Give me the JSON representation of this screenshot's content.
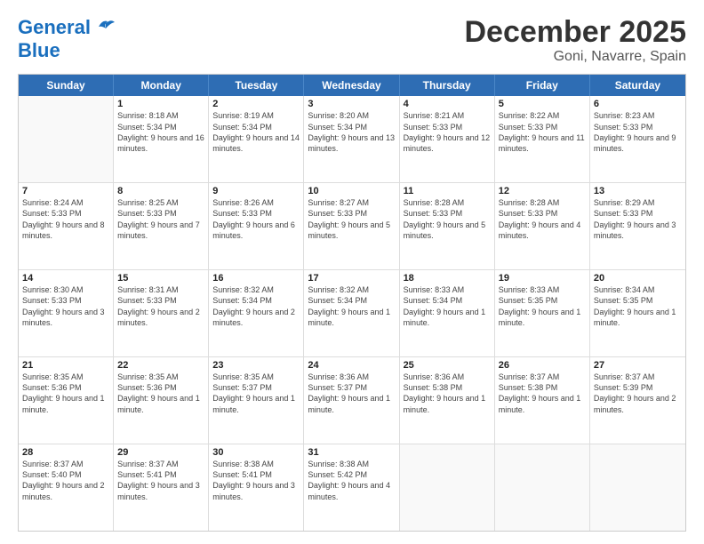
{
  "logo": {
    "line1": "General",
    "line2": "Blue"
  },
  "title": "December 2025",
  "subtitle": "Goni, Navarre, Spain",
  "weekdays": [
    "Sunday",
    "Monday",
    "Tuesday",
    "Wednesday",
    "Thursday",
    "Friday",
    "Saturday"
  ],
  "rows": [
    [
      {
        "day": "",
        "sunrise": "",
        "sunset": "",
        "daylight": ""
      },
      {
        "day": "1",
        "sunrise": "Sunrise: 8:18 AM",
        "sunset": "Sunset: 5:34 PM",
        "daylight": "Daylight: 9 hours and 16 minutes."
      },
      {
        "day": "2",
        "sunrise": "Sunrise: 8:19 AM",
        "sunset": "Sunset: 5:34 PM",
        "daylight": "Daylight: 9 hours and 14 minutes."
      },
      {
        "day": "3",
        "sunrise": "Sunrise: 8:20 AM",
        "sunset": "Sunset: 5:34 PM",
        "daylight": "Daylight: 9 hours and 13 minutes."
      },
      {
        "day": "4",
        "sunrise": "Sunrise: 8:21 AM",
        "sunset": "Sunset: 5:33 PM",
        "daylight": "Daylight: 9 hours and 12 minutes."
      },
      {
        "day": "5",
        "sunrise": "Sunrise: 8:22 AM",
        "sunset": "Sunset: 5:33 PM",
        "daylight": "Daylight: 9 hours and 11 minutes."
      },
      {
        "day": "6",
        "sunrise": "Sunrise: 8:23 AM",
        "sunset": "Sunset: 5:33 PM",
        "daylight": "Daylight: 9 hours and 9 minutes."
      }
    ],
    [
      {
        "day": "7",
        "sunrise": "Sunrise: 8:24 AM",
        "sunset": "Sunset: 5:33 PM",
        "daylight": "Daylight: 9 hours and 8 minutes."
      },
      {
        "day": "8",
        "sunrise": "Sunrise: 8:25 AM",
        "sunset": "Sunset: 5:33 PM",
        "daylight": "Daylight: 9 hours and 7 minutes."
      },
      {
        "day": "9",
        "sunrise": "Sunrise: 8:26 AM",
        "sunset": "Sunset: 5:33 PM",
        "daylight": "Daylight: 9 hours and 6 minutes."
      },
      {
        "day": "10",
        "sunrise": "Sunrise: 8:27 AM",
        "sunset": "Sunset: 5:33 PM",
        "daylight": "Daylight: 9 hours and 5 minutes."
      },
      {
        "day": "11",
        "sunrise": "Sunrise: 8:28 AM",
        "sunset": "Sunset: 5:33 PM",
        "daylight": "Daylight: 9 hours and 5 minutes."
      },
      {
        "day": "12",
        "sunrise": "Sunrise: 8:28 AM",
        "sunset": "Sunset: 5:33 PM",
        "daylight": "Daylight: 9 hours and 4 minutes."
      },
      {
        "day": "13",
        "sunrise": "Sunrise: 8:29 AM",
        "sunset": "Sunset: 5:33 PM",
        "daylight": "Daylight: 9 hours and 3 minutes."
      }
    ],
    [
      {
        "day": "14",
        "sunrise": "Sunrise: 8:30 AM",
        "sunset": "Sunset: 5:33 PM",
        "daylight": "Daylight: 9 hours and 3 minutes."
      },
      {
        "day": "15",
        "sunrise": "Sunrise: 8:31 AM",
        "sunset": "Sunset: 5:33 PM",
        "daylight": "Daylight: 9 hours and 2 minutes."
      },
      {
        "day": "16",
        "sunrise": "Sunrise: 8:32 AM",
        "sunset": "Sunset: 5:34 PM",
        "daylight": "Daylight: 9 hours and 2 minutes."
      },
      {
        "day": "17",
        "sunrise": "Sunrise: 8:32 AM",
        "sunset": "Sunset: 5:34 PM",
        "daylight": "Daylight: 9 hours and 1 minute."
      },
      {
        "day": "18",
        "sunrise": "Sunrise: 8:33 AM",
        "sunset": "Sunset: 5:34 PM",
        "daylight": "Daylight: 9 hours and 1 minute."
      },
      {
        "day": "19",
        "sunrise": "Sunrise: 8:33 AM",
        "sunset": "Sunset: 5:35 PM",
        "daylight": "Daylight: 9 hours and 1 minute."
      },
      {
        "day": "20",
        "sunrise": "Sunrise: 8:34 AM",
        "sunset": "Sunset: 5:35 PM",
        "daylight": "Daylight: 9 hours and 1 minute."
      }
    ],
    [
      {
        "day": "21",
        "sunrise": "Sunrise: 8:35 AM",
        "sunset": "Sunset: 5:36 PM",
        "daylight": "Daylight: 9 hours and 1 minute."
      },
      {
        "day": "22",
        "sunrise": "Sunrise: 8:35 AM",
        "sunset": "Sunset: 5:36 PM",
        "daylight": "Daylight: 9 hours and 1 minute."
      },
      {
        "day": "23",
        "sunrise": "Sunrise: 8:35 AM",
        "sunset": "Sunset: 5:37 PM",
        "daylight": "Daylight: 9 hours and 1 minute."
      },
      {
        "day": "24",
        "sunrise": "Sunrise: 8:36 AM",
        "sunset": "Sunset: 5:37 PM",
        "daylight": "Daylight: 9 hours and 1 minute."
      },
      {
        "day": "25",
        "sunrise": "Sunrise: 8:36 AM",
        "sunset": "Sunset: 5:38 PM",
        "daylight": "Daylight: 9 hours and 1 minute."
      },
      {
        "day": "26",
        "sunrise": "Sunrise: 8:37 AM",
        "sunset": "Sunset: 5:38 PM",
        "daylight": "Daylight: 9 hours and 1 minute."
      },
      {
        "day": "27",
        "sunrise": "Sunrise: 8:37 AM",
        "sunset": "Sunset: 5:39 PM",
        "daylight": "Daylight: 9 hours and 2 minutes."
      }
    ],
    [
      {
        "day": "28",
        "sunrise": "Sunrise: 8:37 AM",
        "sunset": "Sunset: 5:40 PM",
        "daylight": "Daylight: 9 hours and 2 minutes."
      },
      {
        "day": "29",
        "sunrise": "Sunrise: 8:37 AM",
        "sunset": "Sunset: 5:41 PM",
        "daylight": "Daylight: 9 hours and 3 minutes."
      },
      {
        "day": "30",
        "sunrise": "Sunrise: 8:38 AM",
        "sunset": "Sunset: 5:41 PM",
        "daylight": "Daylight: 9 hours and 3 minutes."
      },
      {
        "day": "31",
        "sunrise": "Sunrise: 8:38 AM",
        "sunset": "Sunset: 5:42 PM",
        "daylight": "Daylight: 9 hours and 4 minutes."
      },
      {
        "day": "",
        "sunrise": "",
        "sunset": "",
        "daylight": ""
      },
      {
        "day": "",
        "sunrise": "",
        "sunset": "",
        "daylight": ""
      },
      {
        "day": "",
        "sunrise": "",
        "sunset": "",
        "daylight": ""
      }
    ]
  ]
}
